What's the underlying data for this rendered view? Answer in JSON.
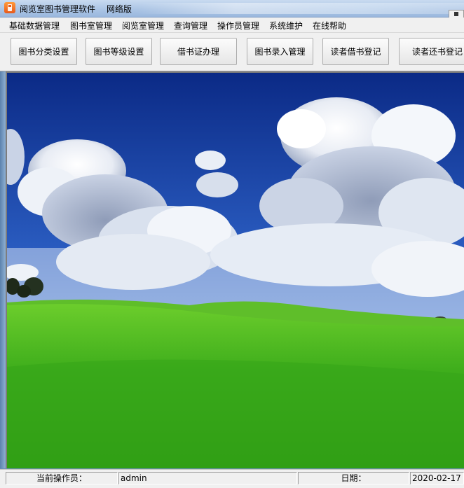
{
  "window": {
    "title": "阅览室图书管理软件",
    "edition": "网络版"
  },
  "menu": {
    "items": [
      "基础数据管理",
      "图书室管理",
      "阅览室管理",
      "查询管理",
      "操作员管理",
      "系统维护",
      "在线帮助"
    ]
  },
  "toolbar": {
    "buttons": [
      "图书分类设置",
      "图书等级设置",
      "借书证办理",
      "图书录入管理",
      "读者借书登记",
      "读者还书登记"
    ]
  },
  "main": {
    "background": "desktop-wallpaper-bliss"
  },
  "statusbar": {
    "operator_label": "当前操作员：",
    "operator_value": "admin",
    "date_label": "日期：",
    "date_value": "2020-02-17"
  },
  "colors": {
    "sky": "#1a3f9a",
    "grass": "#3fae1c",
    "accent": "#e8591a"
  }
}
